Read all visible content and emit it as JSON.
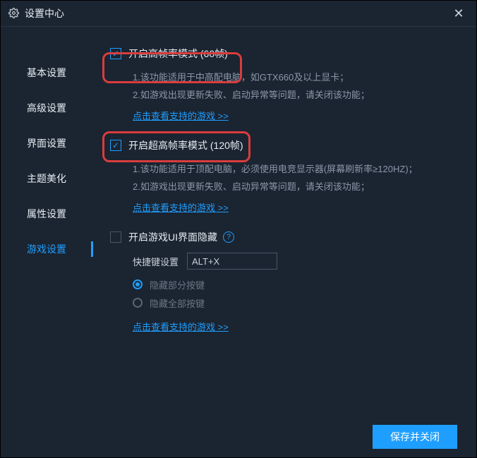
{
  "titlebar": {
    "title": "设置中心"
  },
  "sidebar": {
    "items": [
      {
        "label": "基本设置"
      },
      {
        "label": "高级设置"
      },
      {
        "label": "界面设置"
      },
      {
        "label": "主题美化"
      },
      {
        "label": "属性设置"
      },
      {
        "label": "游戏设置"
      }
    ],
    "active_index": 5
  },
  "options": {
    "high_fps": {
      "label": "开启高帧率模式 (60帧)",
      "note1": "1.该功能适用于中高配电脑，如GTX660及以上显卡；",
      "note2": "2.如游戏出现更新失败、启动异常等问题，请关闭该功能；",
      "link": "点击查看支持的游戏 >>"
    },
    "ultra_fps": {
      "label": "开启超高帧率模式 (120帧)",
      "note1": "1.该功能适用于顶配电脑，必须使用电竞显示器(屏幕刷新率≥120HZ)；",
      "note2": "2.如游戏出现更新失败、启动异常等问题，请关闭该功能；",
      "link": "点击查看支持的游戏 >>"
    },
    "hide_ui": {
      "label": "开启游戏UI界面隐藏",
      "shortcut_label": "快捷键设置",
      "shortcut_value": "ALT+X",
      "radio1": "隐藏部分按键",
      "radio2": "隐藏全部按键",
      "link": "点击查看支持的游戏 >>"
    }
  },
  "footer": {
    "save_label": "保存并关闭"
  }
}
